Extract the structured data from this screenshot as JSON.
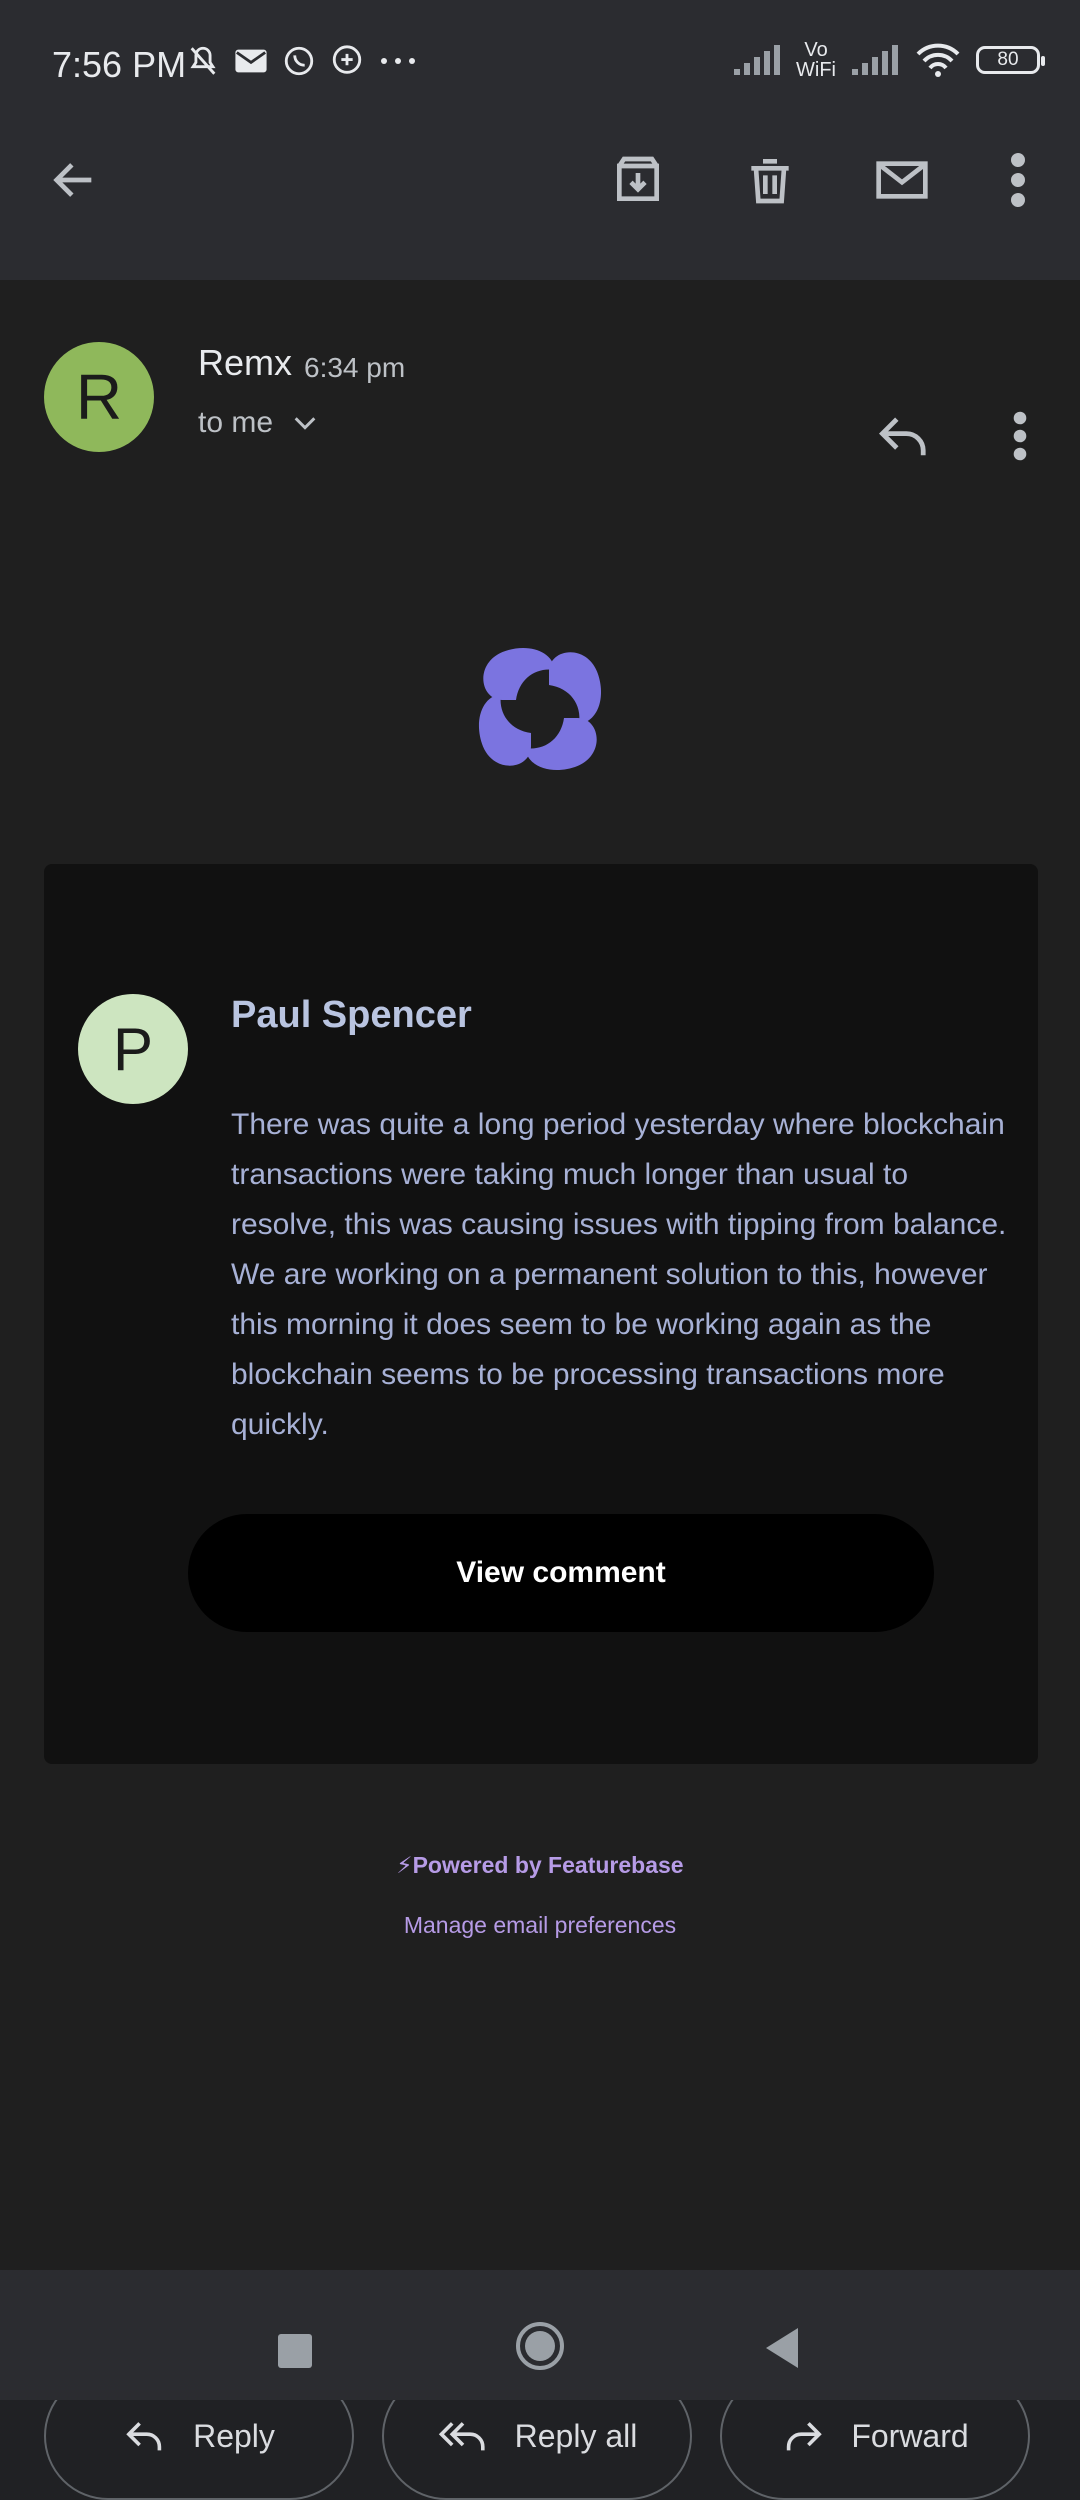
{
  "status_bar": {
    "time": "7:56 PM",
    "network_label_top": "Vo",
    "network_label_bottom": "WiFi",
    "battery": "80"
  },
  "toolbar": {
    "icons": [
      "back-arrow-icon",
      "archive-icon",
      "delete-icon",
      "mark-unread-icon",
      "more-vert-icon"
    ]
  },
  "email": {
    "sender_initial": "R",
    "sender_name": "Remx",
    "time": "6:34 pm",
    "recipient": "to me"
  },
  "comment": {
    "author_initial": "P",
    "author_name": "Paul Spencer",
    "body": "There was quite a long period yesterday where blockchain transactions were taking much longer than usual to resolve, this was causing issues with tipping from balance. We are working on a permanent solution to this, however this morning it does seem to be working again as the blockchain seems to be processing transactions more quickly.",
    "button_label": "View comment"
  },
  "footer": {
    "powered_by": "⚡Powered by Featurebase",
    "manage_prefs": "Manage email preferences"
  },
  "actions": {
    "reply": "Reply",
    "reply_all": "Reply all",
    "forward": "Forward"
  },
  "colors": {
    "sender_avatar": "#8fb85b",
    "commenter_avatar": "#cde5c0",
    "logo": "#7b74e0",
    "link": "#b69be6"
  }
}
